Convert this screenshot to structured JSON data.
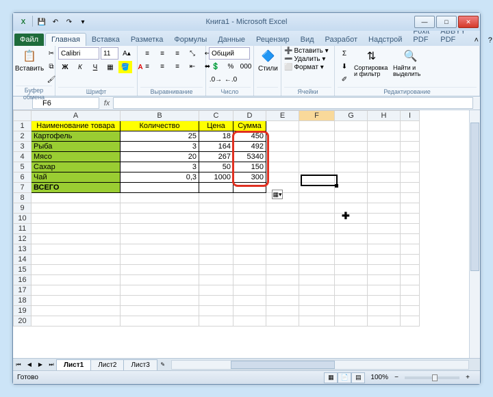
{
  "title": "Книга1 - Microsoft Excel",
  "qat": {
    "excel": "X",
    "save": "💾",
    "undo": "↶",
    "redo": "↷",
    "customize": "▾"
  },
  "tabs": {
    "file": "Файл",
    "items": [
      "Главная",
      "Вставка",
      "Разметка",
      "Формулы",
      "Данные",
      "Рецензир",
      "Вид",
      "Разработ",
      "Надстрой",
      "Foxit PDF",
      "ABBYY PDF"
    ],
    "active_index": 0
  },
  "help_icons": {
    "help": "?",
    "minribbon": "˄",
    "winmin": "–",
    "winclose": "×"
  },
  "ribbon": {
    "clipboard": {
      "label": "Буфер обмена",
      "paste": "Вставить",
      "paste_icon": "📋"
    },
    "font": {
      "label": "Шрифт",
      "name": "Calibri",
      "size": "11"
    },
    "alignment": {
      "label": "Выравнивание"
    },
    "number": {
      "label": "Число",
      "format": "Общий"
    },
    "styles": {
      "label": "",
      "btn": "Стили"
    },
    "cells": {
      "label": "Ячейки",
      "insert": "Вставить ▾",
      "delete": "Удалить ▾",
      "format": "Формат ▾"
    },
    "editing": {
      "label": "Редактирование",
      "sort": "Сортировка и фильтр",
      "find": "Найти и выделить"
    }
  },
  "formula_bar": {
    "namebox": "F6",
    "fx": "fx",
    "value": ""
  },
  "columns": [
    "A",
    "B",
    "C",
    "D",
    "E",
    "F",
    "G",
    "H",
    "I"
  ],
  "headers": {
    "name": "Наименование товара",
    "qty": "Количество",
    "price": "Цена",
    "sum": "Сумма"
  },
  "rows": [
    {
      "name": "Картофель",
      "qty": "25",
      "price": "18",
      "sum": "450"
    },
    {
      "name": "Рыба",
      "qty": "3",
      "price": "164",
      "sum": "492"
    },
    {
      "name": "Мясо",
      "qty": "20",
      "price": "267",
      "sum": "5340"
    },
    {
      "name": "Сахар",
      "qty": "3",
      "price": "50",
      "sum": "150"
    },
    {
      "name": "Чай",
      "qty": "0,3",
      "price": "1000",
      "sum": "300"
    }
  ],
  "total_label": "ВСЕГО",
  "chart_data": {
    "type": "table",
    "columns": [
      "Наименование товара",
      "Количество",
      "Цена",
      "Сумма"
    ],
    "data": [
      [
        "Картофель",
        25,
        18,
        450
      ],
      [
        "Рыба",
        3,
        164,
        492
      ],
      [
        "Мясо",
        20,
        267,
        5340
      ],
      [
        "Сахар",
        3,
        50,
        150
      ],
      [
        "Чай",
        0.3,
        1000,
        300
      ]
    ],
    "total_row": [
      "ВСЕГО",
      null,
      null,
      null
    ]
  },
  "sheets": {
    "items": [
      "Лист1",
      "Лист2",
      "Лист3"
    ],
    "active_index": 0
  },
  "status": {
    "text": "Готово",
    "zoom": "100%"
  },
  "winctrl": {
    "min": "—",
    "max": "□",
    "close": "✕"
  }
}
